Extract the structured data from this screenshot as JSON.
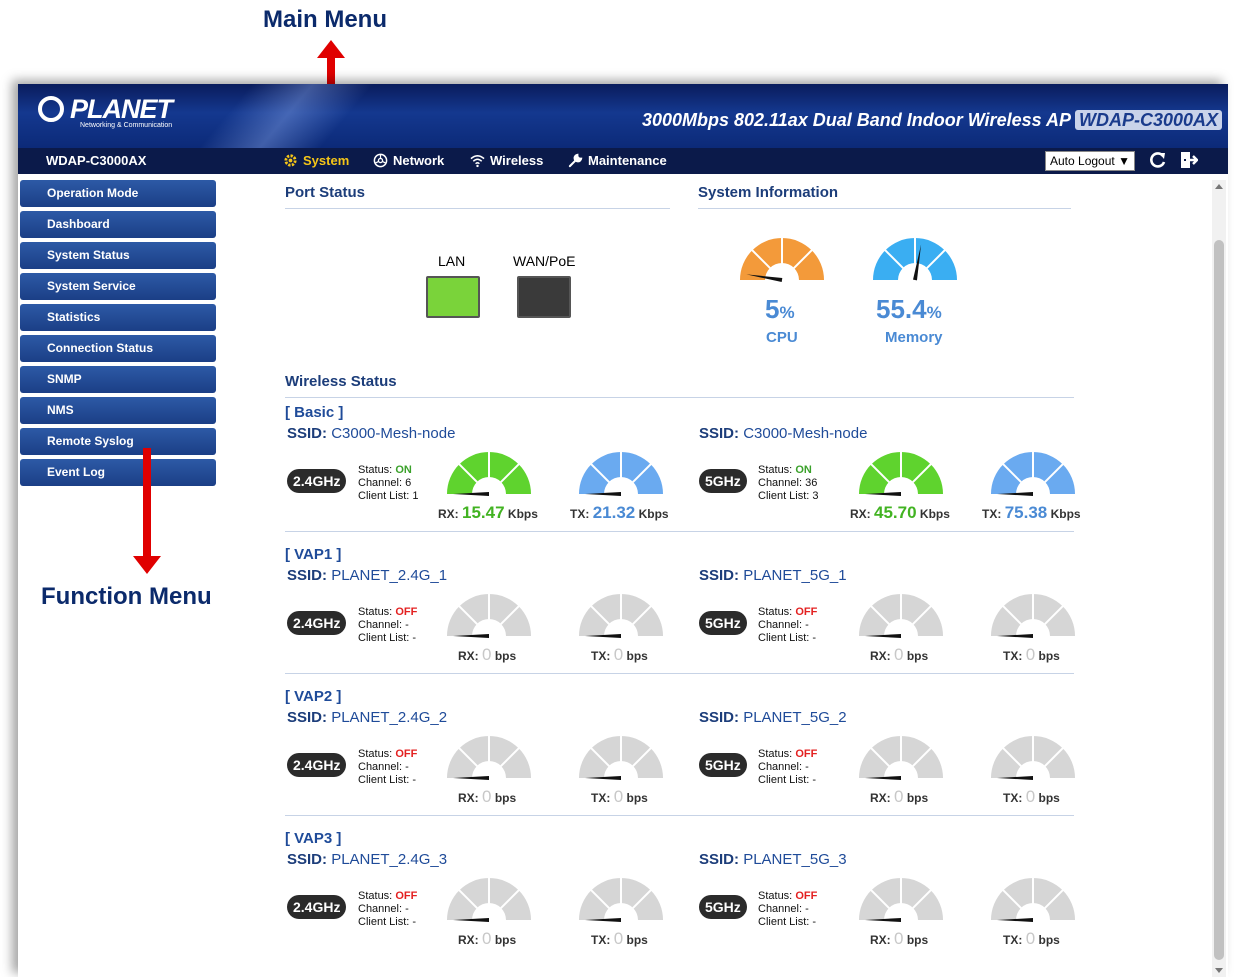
{
  "annotations": {
    "main_menu": "Main Menu",
    "function_menu": "Function Menu"
  },
  "banner": {
    "logo": "PLANET",
    "logo_tagline": "Networking & Communication",
    "product": "3000Mbps 802.11ax Dual Band Indoor Wireless AP",
    "model_badge": "WDAP-C3000AX"
  },
  "menubar": {
    "model": "WDAP-C3000AX",
    "items": [
      {
        "label": "System",
        "icon": "gear-icon",
        "active": true
      },
      {
        "label": "Network",
        "icon": "network-icon"
      },
      {
        "label": "Wireless",
        "icon": "wifi-icon"
      },
      {
        "label": "Maintenance",
        "icon": "wrench-icon"
      }
    ],
    "auto_logout": "Auto Logout",
    "active_color": "#f5c518"
  },
  "sidebar": {
    "items": [
      {
        "label": "Operation Mode"
      },
      {
        "label": "Dashboard"
      },
      {
        "label": "System Status"
      },
      {
        "label": "System Service"
      },
      {
        "label": "Statistics"
      },
      {
        "label": "Connection Status"
      },
      {
        "label": "SNMP"
      },
      {
        "label": "NMS"
      },
      {
        "label": "Remote Syslog"
      },
      {
        "label": "Event Log"
      }
    ]
  },
  "port_status": {
    "title": "Port Status",
    "ports": [
      {
        "label": "LAN",
        "color": "#7ad33a"
      },
      {
        "label": "WAN/PoE",
        "color": "#3a3a3a"
      }
    ]
  },
  "system_info": {
    "title": "System Information",
    "cpu": {
      "value": "5",
      "unit": "%",
      "label": "CPU",
      "fraction": 0.05,
      "color": "#f39a3a"
    },
    "memory": {
      "value": "55.4",
      "unit": "%",
      "label": "Memory",
      "fraction": 0.554,
      "color": "#3aaef2"
    }
  },
  "wireless": {
    "title": "Wireless Status",
    "labels": {
      "ssid": "SSID:",
      "status": "Status:",
      "channel": "Channel:",
      "client": "Client List:",
      "rx": "RX:",
      "tx": "TX:"
    },
    "groups": [
      {
        "title": "[ Basic ]",
        "radios": [
          {
            "ssid": "C3000-Mesh-node",
            "band": "2.4GHz",
            "status": "ON",
            "channel": "6",
            "clients": "1",
            "rx": "15.47",
            "rx_unit": "Kbps",
            "tx": "21.32",
            "tx_unit": "Kbps"
          },
          {
            "ssid": "C3000-Mesh-node",
            "band": "5GHz",
            "status": "ON",
            "channel": "36",
            "clients": "3",
            "rx": "45.70",
            "rx_unit": "Kbps",
            "tx": "75.38",
            "tx_unit": "Kbps"
          }
        ]
      },
      {
        "title": "[ VAP1 ]",
        "radios": [
          {
            "ssid": "PLANET_2.4G_1",
            "band": "2.4GHz",
            "status": "OFF",
            "channel": "-",
            "clients": "-",
            "rx": "0",
            "rx_unit": "bps",
            "tx": "0",
            "tx_unit": "bps"
          },
          {
            "ssid": "PLANET_5G_1",
            "band": "5GHz",
            "status": "OFF",
            "channel": "-",
            "clients": "-",
            "rx": "0",
            "rx_unit": "bps",
            "tx": "0",
            "tx_unit": "bps"
          }
        ]
      },
      {
        "title": "[ VAP2 ]",
        "radios": [
          {
            "ssid": "PLANET_2.4G_2",
            "band": "2.4GHz",
            "status": "OFF",
            "channel": "-",
            "clients": "-",
            "rx": "0",
            "rx_unit": "bps",
            "tx": "0",
            "tx_unit": "bps"
          },
          {
            "ssid": "PLANET_5G_2",
            "band": "5GHz",
            "status": "OFF",
            "channel": "-",
            "clients": "-",
            "rx": "0",
            "rx_unit": "bps",
            "tx": "0",
            "tx_unit": "bps"
          }
        ]
      },
      {
        "title": "[ VAP3 ]",
        "radios": [
          {
            "ssid": "PLANET_2.4G_3",
            "band": "2.4GHz",
            "status": "OFF",
            "channel": "-",
            "clients": "-",
            "rx": "0",
            "rx_unit": "bps",
            "tx": "0",
            "tx_unit": "bps"
          },
          {
            "ssid": "PLANET_5G_3",
            "band": "5GHz",
            "status": "OFF",
            "channel": "-",
            "clients": "-",
            "rx": "0",
            "rx_unit": "bps",
            "tx": "0",
            "tx_unit": "bps"
          }
        ]
      }
    ],
    "colors": {
      "rx_active": "#5fd32e",
      "tx_active": "#6aaaf0",
      "inactive": "#d6d6d6"
    }
  }
}
